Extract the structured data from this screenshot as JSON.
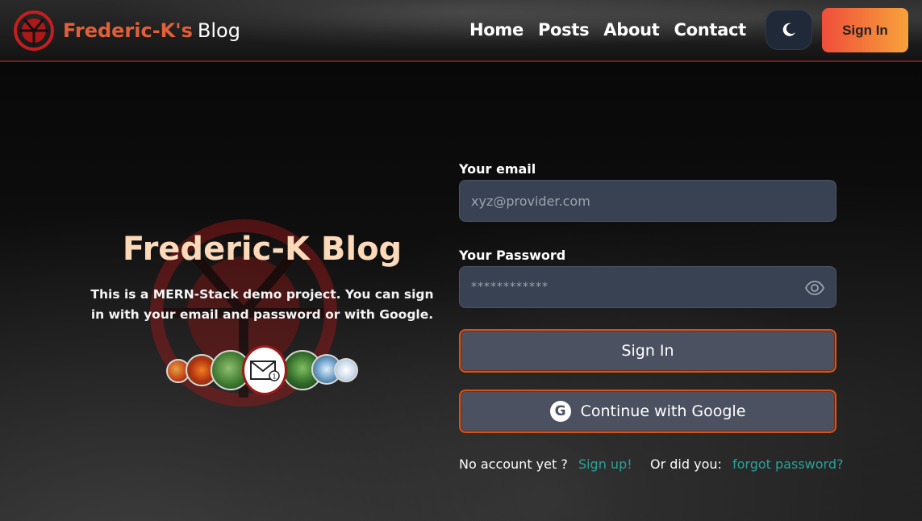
{
  "header": {
    "brand_primary": "Frederic-K's",
    "brand_secondary": "Blog",
    "nav": [
      "Home",
      "Posts",
      "About",
      "Contact"
    ],
    "theme_icon": "moon-icon",
    "signin_label": "Sign In"
  },
  "hero": {
    "title": "Frederic-K Blog",
    "description": "This is a MERN-Stack demo project. You can sign in with your email and password or with Google."
  },
  "form": {
    "email_label": "Your email",
    "email_placeholder": "xyz@provider.com",
    "password_label": "Your Password",
    "password_value": "************",
    "signin_label": "Sign In",
    "google_label": "Continue with Google",
    "google_icon": "G",
    "no_account_text": "No account yet ?",
    "signup_link": "Sign up!",
    "forgot_prefix": "Or did you:",
    "forgot_link": "forgot password?"
  },
  "colors": {
    "accent": "#e0603a",
    "button_border": "#d4541c",
    "link": "#2aa198",
    "title": "#fbd9b9"
  }
}
